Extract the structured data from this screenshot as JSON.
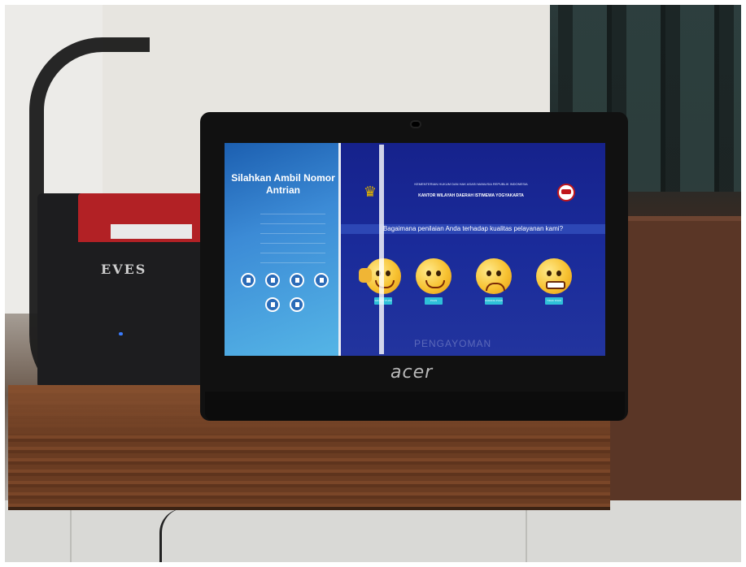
{
  "kiosk": {
    "printer_brand": "EVES",
    "laptop_brand": "acer",
    "queue_panel": {
      "title": "Silahkan Ambil Nomor Antrian"
    },
    "survey_panel": {
      "ministry": "KEMENTERIAN HUKUM DAN HAK ASASI MANUSIA REPUBLIK INDONESIA",
      "office": "KANTOR WILAYAH DAERAH ISTIMEWA YOGYAKARTA",
      "question": "Bagaimana penilaian Anda terhadap kualitas pelayanan kami?",
      "ratings": [
        {
          "label": "SANGAT PUAS",
          "icon": "thumbs-up-smiley-icon"
        },
        {
          "label": "PUAS",
          "icon": "happy-smiley-icon"
        },
        {
          "label": "KURANG PUAS",
          "icon": "sad-smiley-icon"
        },
        {
          "label": "TIDAK PUAS",
          "icon": "grimace-smiley-icon"
        }
      ],
      "watermark": "PENGAYOMAN"
    }
  },
  "colors": {
    "screen_blue": "#16228c",
    "left_pane": "#3c8bd6",
    "rating_button": "#2ec0d9"
  }
}
